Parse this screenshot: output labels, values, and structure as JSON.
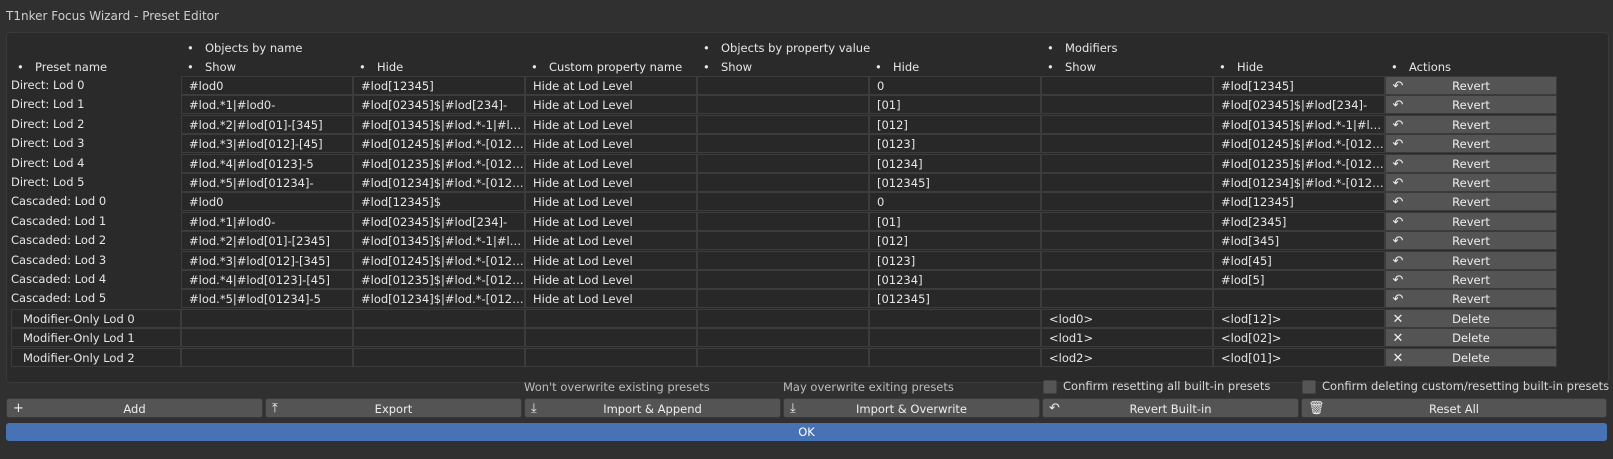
{
  "window": {
    "title": "T1nker Focus Wizard - Preset Editor"
  },
  "headers": {
    "objects_by_name": "Objects by name",
    "objects_by_property_value": "Objects by property value",
    "modifiers": "Modifiers",
    "preset_name": "Preset name",
    "show1": "Show",
    "hide1": "Hide",
    "custom_property_name": "Custom property name",
    "show2": "Show",
    "hide2": "Hide",
    "show3": "Show",
    "hide3": "Hide",
    "actions": "Actions"
  },
  "rows": [
    {
      "name": "Direct: Lod 0",
      "obj_show": "#lod0",
      "obj_hide": "#lod[12345]",
      "prop": "Hide at Lod Level",
      "prop_show": "",
      "prop_hide": "0",
      "mod_show": "",
      "mod_hide": "#lod[12345]",
      "action": "Revert",
      "icon": "revert-icon",
      "boxed": false
    },
    {
      "name": "Direct: Lod 1",
      "obj_show": "#lod.*1|#lod0-",
      "obj_hide": "#lod[02345]$|#lod[234]-",
      "prop": "Hide at Lod Level",
      "prop_show": "",
      "prop_hide": "[01]",
      "mod_show": "",
      "mod_hide": "#lod[02345]$|#lod[234]-",
      "action": "Revert",
      "icon": "revert-icon",
      "boxed": false
    },
    {
      "name": "Direct: Lod 2",
      "obj_show": "#lod.*2|#lod[01]-[345]",
      "obj_hide": "#lod[01345]$|#lod.*-1|#lod[...",
      "prop": "Hide at Lod Level",
      "prop_show": "",
      "prop_hide": "[012]",
      "mod_show": "",
      "mod_hide": "#lod[01345]$|#lod.*-1|#lod[...",
      "action": "Revert",
      "icon": "revert-icon",
      "boxed": false
    },
    {
      "name": "Direct: Lod 3",
      "obj_show": "#lod.*3|#lod[012]-[45]",
      "obj_hide": "#lod[01245]$|#lod.*-[012]|#...",
      "prop": "Hide at Lod Level",
      "prop_show": "",
      "prop_hide": "[0123]",
      "mod_show": "",
      "mod_hide": "#lod[01245]$|#lod.*-[012]|#...",
      "action": "Revert",
      "icon": "revert-icon",
      "boxed": false
    },
    {
      "name": "Direct: Lod 4",
      "obj_show": "#lod.*4|#lod[0123]-5",
      "obj_hide": "#lod[01235]$|#lod.*-[0123]|...",
      "prop": "Hide at Lod Level",
      "prop_show": "",
      "prop_hide": "[01234]",
      "mod_show": "",
      "mod_hide": "#lod[01235]$|#lod.*-[0123]|...",
      "action": "Revert",
      "icon": "revert-icon",
      "boxed": false
    },
    {
      "name": "Direct: Lod 5",
      "obj_show": "#lod.*5|#lod[01234]-",
      "obj_hide": "#lod[01234]$|#lod.*-[01234]",
      "prop": "Hide at Lod Level",
      "prop_show": "",
      "prop_hide": "[012345]",
      "mod_show": "",
      "mod_hide": "#lod[01234]$|#lod.*-[01234]",
      "action": "Revert",
      "icon": "revert-icon",
      "boxed": false
    },
    {
      "name": "Cascaded: Lod 0",
      "obj_show": "#lod0",
      "obj_hide": "#lod[12345]$",
      "prop": "Hide at Lod Level",
      "prop_show": "",
      "prop_hide": "0",
      "mod_show": "",
      "mod_hide": "#lod[12345]",
      "action": "Revert",
      "icon": "revert-icon",
      "boxed": false
    },
    {
      "name": "Cascaded: Lod 1",
      "obj_show": "#lod.*1|#lod0-",
      "obj_hide": "#lod[02345]$|#lod[234]-",
      "prop": "Hide at Lod Level",
      "prop_show": "",
      "prop_hide": "[01]",
      "mod_show": "",
      "mod_hide": "#lod[2345]",
      "action": "Revert",
      "icon": "revert-icon",
      "boxed": false
    },
    {
      "name": "Cascaded: Lod 2",
      "obj_show": "#lod.*2|#lod[01]-[2345]",
      "obj_hide": "#lod[01345]$|#lod.*-1|#lod[...",
      "prop": "Hide at Lod Level",
      "prop_show": "",
      "prop_hide": "[012]",
      "mod_show": "",
      "mod_hide": "#lod[345]",
      "action": "Revert",
      "icon": "revert-icon",
      "boxed": false
    },
    {
      "name": "Cascaded: Lod 3",
      "obj_show": "#lod.*3|#lod[012]-[345]",
      "obj_hide": "#lod[01245]$|#lod.*-[012]|#...",
      "prop": "Hide at Lod Level",
      "prop_show": "",
      "prop_hide": "[0123]",
      "mod_show": "",
      "mod_hide": "#lod[45]",
      "action": "Revert",
      "icon": "revert-icon",
      "boxed": false
    },
    {
      "name": "Cascaded: Lod 4",
      "obj_show": "#lod.*4|#lod[0123]-[45]",
      "obj_hide": "#lod[01235]$|#lod.*-[0123]|...",
      "prop": "Hide at Lod Level",
      "prop_show": "",
      "prop_hide": "[01234]",
      "mod_show": "",
      "mod_hide": "#lod[5]",
      "action": "Revert",
      "icon": "revert-icon",
      "boxed": false
    },
    {
      "name": "Cascaded: Lod 5",
      "obj_show": "#lod.*5|#lod[01234]-5",
      "obj_hide": "#lod[01234]$|#lod.*-[01234]",
      "prop": "Hide at Lod Level",
      "prop_show": "",
      "prop_hide": "[012345]",
      "mod_show": "",
      "mod_hide": "",
      "action": "Revert",
      "icon": "revert-icon",
      "boxed": false
    },
    {
      "name": "Modifier-Only Lod 0",
      "obj_show": "",
      "obj_hide": "",
      "prop": "",
      "prop_show": "",
      "prop_hide": "",
      "mod_show": "<lod0>",
      "mod_hide": "<lod[12]>",
      "action": "Delete",
      "icon": "close-icon",
      "boxed": true
    },
    {
      "name": "Modifier-Only Lod 1",
      "obj_show": "",
      "obj_hide": "",
      "prop": "",
      "prop_show": "",
      "prop_hide": "",
      "mod_show": "<lod1>",
      "mod_hide": "<lod[02]>",
      "action": "Delete",
      "icon": "close-icon",
      "boxed": true
    },
    {
      "name": "Modifier-Only Lod 2",
      "obj_show": "",
      "obj_hide": "",
      "prop": "",
      "prop_show": "",
      "prop_hide": "",
      "mod_show": "<lod2>",
      "mod_hide": "<lod[01]>",
      "action": "Delete",
      "icon": "close-icon",
      "boxed": true
    }
  ],
  "hints": {
    "append": "Won't overwrite existing presets",
    "overwrite": "May overwrite exiting presets"
  },
  "checkboxes": {
    "confirm_reset": "Confirm resetting all built-in presets",
    "confirm_delete": "Confirm deleting custom/resetting built-in presets"
  },
  "buttons": {
    "add": "Add",
    "export": "Export",
    "import_append": "Import & Append",
    "import_overwrite": "Import & Overwrite",
    "revert_builtin": "Revert Built-in",
    "reset_all": "Reset All",
    "ok": "OK"
  },
  "colors": {
    "accent": "#4772b3",
    "background": "#303030",
    "button": "#545454"
  }
}
